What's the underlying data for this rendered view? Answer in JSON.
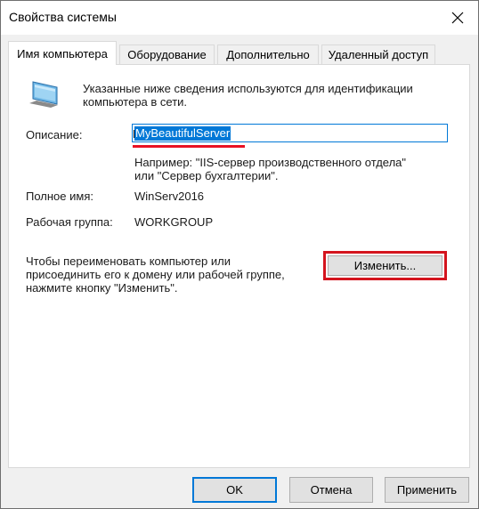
{
  "window": {
    "title": "Свойства системы"
  },
  "tabs": [
    {
      "label": "Имя компьютера",
      "active": true
    },
    {
      "label": "Оборудование",
      "active": false
    },
    {
      "label": "Дополнительно",
      "active": false
    },
    {
      "label": "Удаленный доступ",
      "active": false
    }
  ],
  "info": {
    "line1": "Указанные ниже сведения используются для идентификации",
    "line2": "компьютера в сети."
  },
  "description": {
    "label": "Описание:",
    "value": "MyBeautifulServer",
    "hint_line1": "Например: \"IIS-сервер производственного отдела\"",
    "hint_line2": "или \"Сервер бухгалтерии\"."
  },
  "full_name": {
    "label": "Полное имя:",
    "value": "WinServ2016"
  },
  "workgroup": {
    "label": "Рабочая группа:",
    "value": "WORKGROUP"
  },
  "rename": {
    "line1": "Чтобы переименовать компьютер или",
    "line2": "присоединить его к домену или рабочей группе,",
    "line3": "нажмите кнопку \"Изменить\".",
    "button": "Изменить..."
  },
  "buttons": {
    "ok": "OK",
    "cancel": "Отмена",
    "apply": "Применить"
  },
  "colors": {
    "accent": "#0078d7",
    "highlight": "#d4141e"
  }
}
